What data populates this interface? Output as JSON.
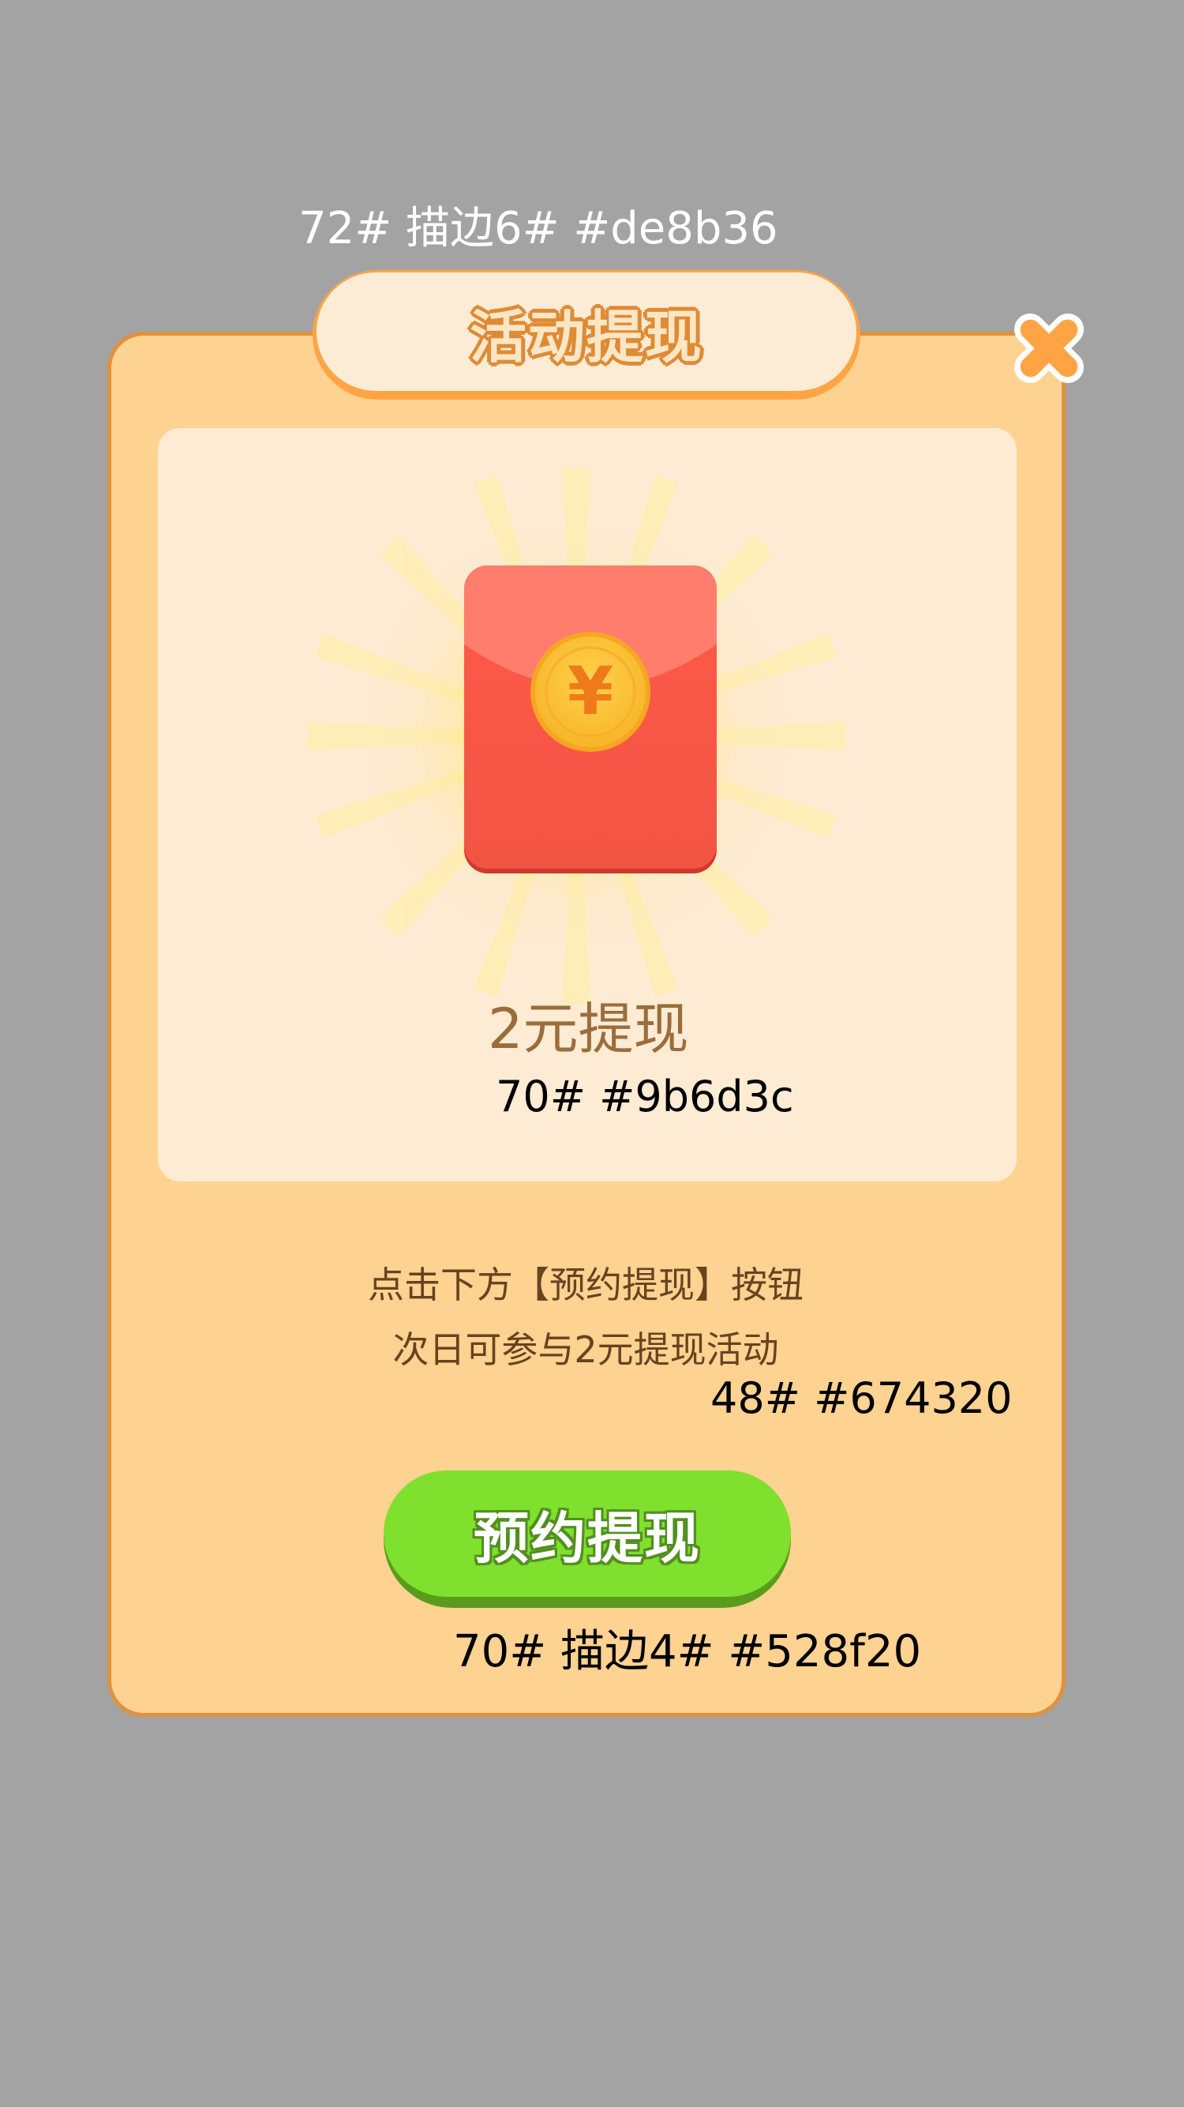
{
  "annotations": {
    "title_spec": "72# 描边6# #de8b36",
    "amount_spec": "70# #9b6d3c",
    "description_spec": "48# #674320",
    "button_spec": "70# 描边4# #528f20"
  },
  "dialog": {
    "title": "活动提现",
    "amount_label": "2元提现",
    "description_line1": "点击下方【预约提现】按钮",
    "description_line2": "次日可参与2元提现活动",
    "cta_label": "预约提现",
    "envelope_symbol": "¥"
  },
  "colors": {
    "overlay": "#a3a3a3",
    "panel": "#fed291",
    "panel_border": "#e0913e",
    "title_stroke": "#de8b36",
    "amount_text": "#9b6d3c",
    "description_text": "#674320",
    "button": "#7fe02e",
    "button_stroke": "#528f20",
    "close_icon": "#ffa444"
  },
  "icons": {
    "close": "close-icon",
    "envelope": "red-envelope-icon",
    "coin": "yuan-coin-icon"
  }
}
